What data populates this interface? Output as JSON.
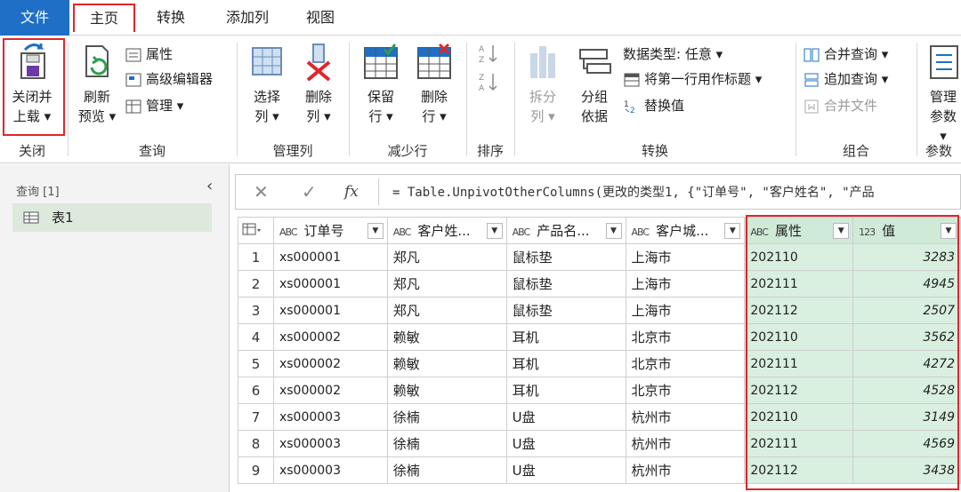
{
  "tabs": {
    "file": "文件",
    "home": "主页",
    "convert": "转换",
    "add_column": "添加列",
    "view": "视图"
  },
  "ribbon": {
    "close": {
      "btn_line1": "关闭并",
      "btn_line2": "上载",
      "group": "关闭"
    },
    "query": {
      "refresh_line1": "刷新",
      "refresh_line2": "预览",
      "properties": "属性",
      "advanced_editor": "高级编辑器",
      "manage": "管理",
      "group": "查询"
    },
    "manage_columns": {
      "choose_line1": "选择",
      "choose_line2": "列",
      "remove_line1": "删除",
      "remove_line2": "列",
      "group": "管理列"
    },
    "reduce_rows": {
      "keep_line1": "保留",
      "keep_line2": "行",
      "remove_line1": "删除",
      "remove_line2": "行",
      "group": "减少行"
    },
    "sort": {
      "group": "排序"
    },
    "transform": {
      "split_line1": "拆分",
      "split_line2": "列",
      "groupby_line1": "分组",
      "groupby_line2": "依据",
      "datatype": "数据类型: 任意",
      "first_row_header": "将第一行用作标题",
      "replace_values": "替换值",
      "group": "转换"
    },
    "combine": {
      "merge_queries": "合并查询",
      "append_queries": "追加查询",
      "combine_files": "合并文件",
      "group": "组合"
    },
    "params": {
      "manage_line1": "管理",
      "manage_line2": "参数",
      "group": "参数"
    }
  },
  "left_pane": {
    "queries_label": "查询 [1]",
    "item": "表1"
  },
  "formula": {
    "cancel": "✕",
    "confirm": "✓",
    "fx": "fx",
    "text": "= Table.UnpivotOtherColumns(更改的类型1, {\"订单号\", \"客户姓名\", \"产品"
  },
  "table": {
    "headers": [
      {
        "type": "ABC",
        "label": "订单号"
      },
      {
        "type": "ABC",
        "label": "客户姓..."
      },
      {
        "type": "ABC",
        "label": "产品名..."
      },
      {
        "type": "ABC",
        "label": "客户城..."
      },
      {
        "type": "ABC",
        "label": "属性"
      },
      {
        "type": "123",
        "label": "值"
      }
    ],
    "rows": [
      [
        "1",
        "xs000001",
        "郑凡",
        "鼠标垫",
        "上海市",
        "202110",
        "3283"
      ],
      [
        "2",
        "xs000001",
        "郑凡",
        "鼠标垫",
        "上海市",
        "202111",
        "4945"
      ],
      [
        "3",
        "xs000001",
        "郑凡",
        "鼠标垫",
        "上海市",
        "202112",
        "2507"
      ],
      [
        "4",
        "xs000002",
        "赖敏",
        "耳机",
        "北京市",
        "202110",
        "3562"
      ],
      [
        "5",
        "xs000002",
        "赖敏",
        "耳机",
        "北京市",
        "202111",
        "4272"
      ],
      [
        "6",
        "xs000002",
        "赖敏",
        "耳机",
        "北京市",
        "202112",
        "4528"
      ],
      [
        "7",
        "xs000003",
        "徐楠",
        "U盘",
        "杭州市",
        "202110",
        "3149"
      ],
      [
        "8",
        "xs000003",
        "徐楠",
        "U盘",
        "杭州市",
        "202111",
        "4569"
      ],
      [
        "9",
        "xs000003",
        "徐楠",
        "U盘",
        "杭州市",
        "202112",
        "3438"
      ]
    ]
  },
  "colors": {
    "file_tab": "#1e6fc5",
    "highlight_red": "#e0262a",
    "selected_col": "#d9efe0"
  }
}
